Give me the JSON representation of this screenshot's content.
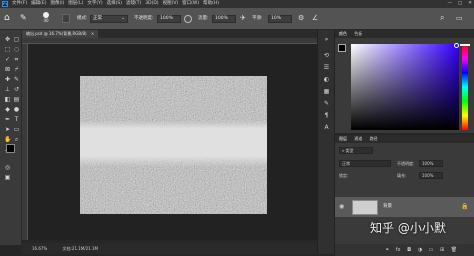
{
  "menubar": {
    "app_icon": "Ps",
    "items": [
      "文件(F)",
      "编辑(E)",
      "图像(I)",
      "图层(L)",
      "文字(Y)",
      "选择(S)",
      "滤镜(T)",
      "3D(D)",
      "视图(V)",
      "窗口(W)",
      "帮助(H)"
    ],
    "window_controls": [
      "—",
      "□",
      "✕"
    ]
  },
  "options_bar": {
    "brush_size": "40",
    "mode_label": "模式:",
    "mode_value": "正常",
    "opacity_label": "不透明度:",
    "opacity_value": "100%",
    "flow_label": "流量:",
    "flow_value": "100%",
    "smoothing_label": "平滑:",
    "smoothing_value": "10%"
  },
  "document_tab": {
    "title": "输出.psd @ 16.7%(背景,RGB/8)",
    "close_symbol": "×"
  },
  "statusbar": {
    "zoom": "16.67%",
    "doc_info": "文档:21.1M/21.1M"
  },
  "color_panel": {
    "tabs": [
      "颜色",
      "色板"
    ],
    "foreground_color": "#000000",
    "background_color": "#ffffff"
  },
  "layers_panel": {
    "tabs": [
      "图层",
      "通道",
      "路径"
    ],
    "filter_label": "类型",
    "blend_mode": "正常",
    "opacity_label": "不透明度:",
    "opacity_value": "100%",
    "lock_label": "锁定:",
    "fill_label": "填充:",
    "fill_value": "100%",
    "layers": [
      {
        "name": "背景",
        "visible": true,
        "locked": true
      }
    ],
    "footer_icons": [
      "link-icon",
      "fx-icon",
      "mask-icon",
      "adjustment-icon",
      "group-icon",
      "new-layer-icon",
      "trash-icon"
    ]
  },
  "watermark": "知乎 @小小默"
}
